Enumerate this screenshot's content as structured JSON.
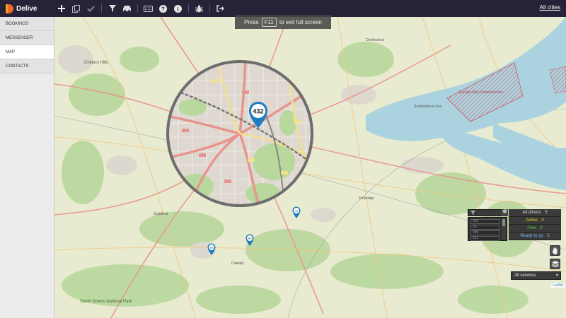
{
  "app": {
    "name": "Delive",
    "brand_orange": "#f06a24",
    "brand_yellow": "#f6a01a",
    "topbar_color": "#262338"
  },
  "toolbar": {
    "icons": [
      "plus-icon",
      "copy-icon",
      "check-icon",
      "filter-icon",
      "taxi-icon",
      "keyboard-icon",
      "help-icon",
      "info-icon",
      "bug-icon",
      "logout-icon"
    ],
    "all_cities": "All cities"
  },
  "sidebar": {
    "items": [
      {
        "label": "BOOKINGS",
        "active": false
      },
      {
        "label": "MESSENGER",
        "active": false
      },
      {
        "label": "MAP",
        "active": true
      },
      {
        "label": "CONTACTS",
        "active": false
      }
    ]
  },
  "fullscreen_notice": {
    "pre": "Press",
    "key": "F11",
    "post": "to exit full screen"
  },
  "map": {
    "zoom_marker": "432",
    "small_markers": [
      "13",
      "360",
      "333"
    ],
    "labels": {
      "chiltern": "Chiltern Hills",
      "chelmsford": "Chelmsford",
      "southend": "Southend-on-Sea",
      "downs": "South Downs National Park",
      "danger": "Dengie (Mid) Shoeburyness",
      "tonbridge": "Tonbridge",
      "crawley": "Crawley",
      "guildford": "Guildford"
    }
  },
  "driver_panel": {
    "list": [
      "002",
      "33",
      "090",
      "111"
    ],
    "all_drivers_label": "All drivers",
    "all_drivers_count": "5",
    "active_label": "Active",
    "active_count": "0",
    "free_label": "Free",
    "free_count": "0",
    "ready_label": "Ready to go",
    "ready_count": "5"
  },
  "services": {
    "selected": "All services"
  },
  "attribution": "Leaflet"
}
